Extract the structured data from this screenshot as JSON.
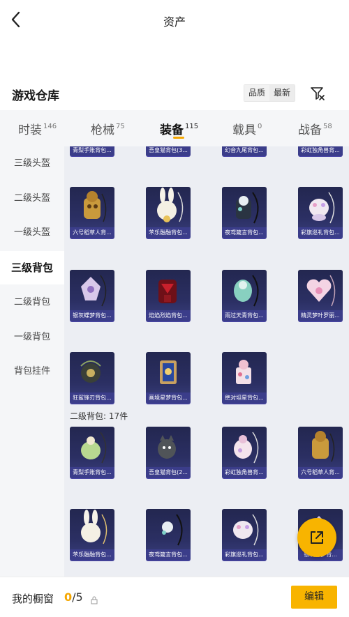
{
  "header": {
    "title": "资产"
  },
  "section": {
    "title": "游戏仓库",
    "sort_options": [
      "品质",
      "最新"
    ]
  },
  "tabs": [
    {
      "label": "时装",
      "count": "146"
    },
    {
      "label": "枪械",
      "count": "75"
    },
    {
      "label": "装备",
      "count": "115"
    },
    {
      "label": "载具",
      "count": "0"
    },
    {
      "label": "战备",
      "count": "58"
    }
  ],
  "sidebar": {
    "items": [
      "三级头盔",
      "二级头盔",
      "一级头盔",
      "三级背包",
      "二级背包",
      "一级背包",
      "背包挂件"
    ]
  },
  "content": {
    "top_partial": [
      "青梨手账背包...",
      "吾皇猫背包(3...",
      "幻音九尾背包...",
      "彩虹独角兽背..."
    ],
    "level3_items": [
      "六号稻草人背...",
      "芣乐融融背包...",
      "夜鸢箴言背包...",
      "彩旗巡礼背包...",
      "银灰蝶梦背包...",
      "焰焰烈焰背包...",
      "雨过天青背包...",
      "精灵梦叶罗丽...",
      "狂鲨锋刃背包...",
      "画境星梦背包...",
      "绝对坦星背包..."
    ],
    "group_label": "二级背包: 17件",
    "level2_items": [
      "青梨手账背包...",
      "吾皇猫背包(2...",
      "彩虹独角兽背...",
      "六号稻草人背...",
      "芣乐融融背包...",
      "夜鸢箴言背包...",
      "彩旗巡礼背包...",
      "银灰蝶梦背..."
    ]
  },
  "bottom": {
    "label": "我的橱窗",
    "count_current": "0",
    "count_total": "/5",
    "edit_label": "编辑"
  },
  "colors": {
    "accent": "#f8b400",
    "card_bg": "#2b2f63",
    "label_bg": "#3b3d8a"
  }
}
